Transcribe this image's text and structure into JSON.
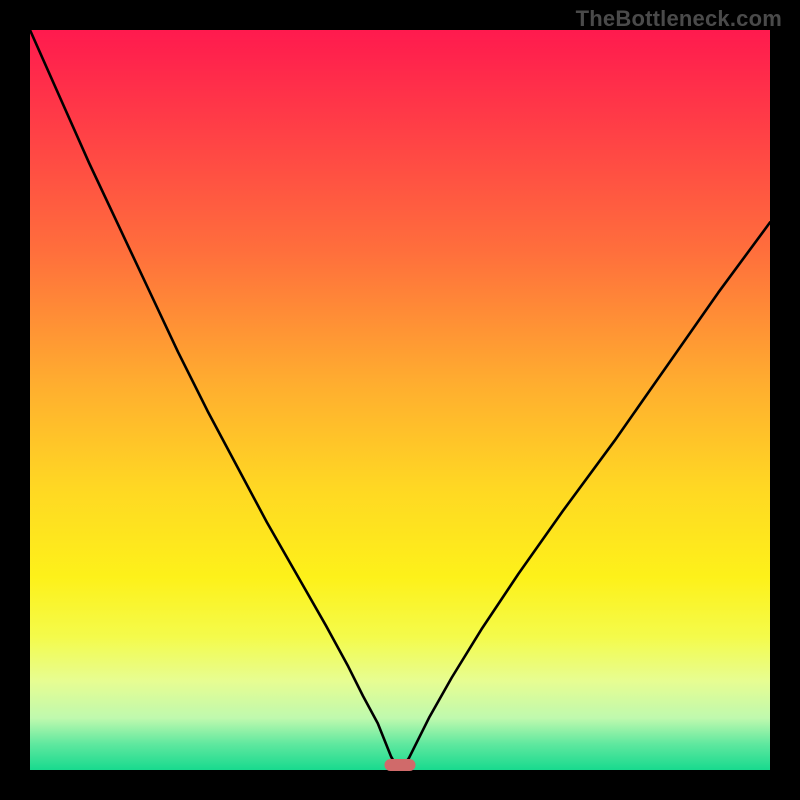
{
  "watermark": {
    "text": "TheBottleneck.com"
  },
  "chart_data": {
    "type": "line",
    "title": "",
    "xlabel": "",
    "ylabel": "",
    "xlim": [
      0,
      100
    ],
    "ylim": [
      0,
      100
    ],
    "grid": false,
    "background_gradient": {
      "stops": [
        {
          "offset": 0.0,
          "color": "#ff1a4e"
        },
        {
          "offset": 0.12,
          "color": "#ff3b47"
        },
        {
          "offset": 0.3,
          "color": "#ff6f3c"
        },
        {
          "offset": 0.48,
          "color": "#ffae2f"
        },
        {
          "offset": 0.62,
          "color": "#ffd823"
        },
        {
          "offset": 0.74,
          "color": "#fdf11a"
        },
        {
          "offset": 0.82,
          "color": "#f4fb4b"
        },
        {
          "offset": 0.88,
          "color": "#e7fd92"
        },
        {
          "offset": 0.93,
          "color": "#bff9ae"
        },
        {
          "offset": 0.965,
          "color": "#5fe89f"
        },
        {
          "offset": 1.0,
          "color": "#18da8e"
        }
      ]
    },
    "series": [
      {
        "name": "bottleneck-curve",
        "x": [
          0,
          4,
          8,
          12,
          16,
          20,
          24,
          28,
          32,
          36,
          40,
          43,
          45,
          47,
          48,
          48.8,
          49.5,
          50.5,
          51.2,
          52,
          54,
          57,
          61,
          66,
          72,
          79,
          86,
          93,
          100
        ],
        "y": [
          100,
          91,
          82,
          73.5,
          65,
          56.5,
          48.5,
          41,
          33.5,
          26.5,
          19.5,
          14,
          10,
          6.3,
          3.8,
          1.8,
          0.6,
          0.6,
          1.6,
          3.2,
          7.2,
          12.5,
          19,
          26.5,
          35,
          44.5,
          54.5,
          64.5,
          74
        ]
      }
    ],
    "marker": {
      "name": "optimal-range-marker",
      "x_center": 50,
      "x_width": 4.2,
      "y": 0,
      "color": "#d06a6a"
    }
  }
}
